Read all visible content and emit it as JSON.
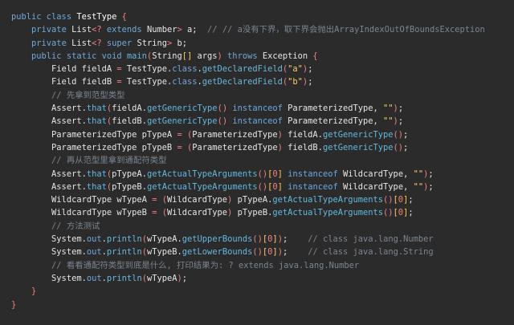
{
  "colors": {
    "background": "#2b2b2b",
    "keyword": "#6fa8dc",
    "method": "#66b8dd",
    "string": "#ffcc66",
    "comment": "#7a8590",
    "operator": "#f08080",
    "default": "#e6e6e6"
  },
  "lines": [
    [
      [
        "keyword",
        "public class "
      ],
      [
        "class",
        "TestType"
      ],
      [
        "brace",
        " {"
      ]
    ],
    [
      [
        "plain",
        "    "
      ],
      [
        "keyword",
        "private "
      ],
      [
        "type",
        "List"
      ],
      [
        "operator",
        "<? "
      ],
      [
        "keyword",
        "extends "
      ],
      [
        "type",
        "Number"
      ],
      [
        "operator",
        "> "
      ],
      [
        "ident",
        "a"
      ],
      [
        "punct",
        ";  "
      ],
      [
        "comment",
        "// // a没有下界，取下界会抛出ArrayIndexOutOfBoundsException"
      ]
    ],
    [
      [
        "plain",
        "    "
      ],
      [
        "keyword",
        "private "
      ],
      [
        "type",
        "List"
      ],
      [
        "operator",
        "<? "
      ],
      [
        "keyword",
        "super "
      ],
      [
        "type",
        "String"
      ],
      [
        "operator",
        "> "
      ],
      [
        "ident",
        "b"
      ],
      [
        "punct",
        ";"
      ]
    ],
    [
      [
        "plain",
        "    "
      ],
      [
        "keyword",
        "public static void "
      ],
      [
        "method",
        "main"
      ],
      [
        "paren",
        "("
      ],
      [
        "type",
        "String"
      ],
      [
        "bracket",
        "[]"
      ],
      [
        "ident",
        " args"
      ],
      [
        "paren",
        ")"
      ],
      [
        "keyword",
        " throws "
      ],
      [
        "type",
        "Exception"
      ],
      [
        "brace",
        " {"
      ]
    ],
    [
      [
        "plain",
        "        "
      ],
      [
        "type",
        "Field "
      ],
      [
        "ident",
        "fieldA"
      ],
      [
        "operator",
        " = "
      ],
      [
        "type",
        "TestType"
      ],
      [
        "punct",
        "."
      ],
      [
        "keyword",
        "class"
      ],
      [
        "punct",
        "."
      ],
      [
        "method",
        "getDeclaredField"
      ],
      [
        "paren",
        "("
      ],
      [
        "string",
        "\"a\""
      ],
      [
        "paren",
        ")"
      ],
      [
        "punct",
        ";"
      ]
    ],
    [
      [
        "plain",
        "        "
      ],
      [
        "type",
        "Field "
      ],
      [
        "ident",
        "fieldB"
      ],
      [
        "operator",
        " = "
      ],
      [
        "type",
        "TestType"
      ],
      [
        "punct",
        "."
      ],
      [
        "keyword",
        "class"
      ],
      [
        "punct",
        "."
      ],
      [
        "method",
        "getDeclaredField"
      ],
      [
        "paren",
        "("
      ],
      [
        "string",
        "\"b\""
      ],
      [
        "paren",
        ")"
      ],
      [
        "punct",
        ";"
      ]
    ],
    [
      [
        "plain",
        "        "
      ],
      [
        "comment",
        "// 先拿到范型类型"
      ]
    ],
    [
      [
        "plain",
        "        "
      ],
      [
        "type",
        "Assert"
      ],
      [
        "punct",
        "."
      ],
      [
        "method",
        "that"
      ],
      [
        "paren",
        "("
      ],
      [
        "ident",
        "fieldA"
      ],
      [
        "punct",
        "."
      ],
      [
        "method",
        "getGenericType"
      ],
      [
        "paren",
        "()"
      ],
      [
        "keyword",
        " instanceof "
      ],
      [
        "type",
        "ParameterizedType"
      ],
      [
        "punct",
        ", "
      ],
      [
        "string",
        "\"\""
      ],
      [
        "paren",
        ")"
      ],
      [
        "punct",
        ";"
      ]
    ],
    [
      [
        "plain",
        "        "
      ],
      [
        "type",
        "Assert"
      ],
      [
        "punct",
        "."
      ],
      [
        "method",
        "that"
      ],
      [
        "paren",
        "("
      ],
      [
        "ident",
        "fieldB"
      ],
      [
        "punct",
        "."
      ],
      [
        "method",
        "getGenericType"
      ],
      [
        "paren",
        "()"
      ],
      [
        "keyword",
        " instanceof "
      ],
      [
        "type",
        "ParameterizedType"
      ],
      [
        "punct",
        ", "
      ],
      [
        "string",
        "\"\""
      ],
      [
        "paren",
        ")"
      ],
      [
        "punct",
        ";"
      ]
    ],
    [
      [
        "plain",
        "        "
      ],
      [
        "type",
        "ParameterizedType "
      ],
      [
        "ident",
        "pTypeA"
      ],
      [
        "operator",
        " = "
      ],
      [
        "paren",
        "("
      ],
      [
        "type",
        "ParameterizedType"
      ],
      [
        "paren",
        ")"
      ],
      [
        "ident",
        " fieldA"
      ],
      [
        "punct",
        "."
      ],
      [
        "method",
        "getGenericType"
      ],
      [
        "paren",
        "()"
      ],
      [
        "punct",
        ";"
      ]
    ],
    [
      [
        "plain",
        "        "
      ],
      [
        "type",
        "ParameterizedType "
      ],
      [
        "ident",
        "pTypeB"
      ],
      [
        "operator",
        " = "
      ],
      [
        "paren",
        "("
      ],
      [
        "type",
        "ParameterizedType"
      ],
      [
        "paren",
        ")"
      ],
      [
        "ident",
        " fieldB"
      ],
      [
        "punct",
        "."
      ],
      [
        "method",
        "getGenericType"
      ],
      [
        "paren",
        "()"
      ],
      [
        "punct",
        ";"
      ]
    ],
    [
      [
        "plain",
        "        "
      ],
      [
        "comment",
        "// 再从范型里拿到通配符类型"
      ]
    ],
    [
      [
        "plain",
        "        "
      ],
      [
        "type",
        "Assert"
      ],
      [
        "punct",
        "."
      ],
      [
        "method",
        "that"
      ],
      [
        "paren",
        "("
      ],
      [
        "ident",
        "pTypeA"
      ],
      [
        "punct",
        "."
      ],
      [
        "method",
        "getActualTypeArguments"
      ],
      [
        "paren",
        "()"
      ],
      [
        "bracket",
        "["
      ],
      [
        "number",
        "0"
      ],
      [
        "bracket",
        "]"
      ],
      [
        "keyword",
        " instanceof "
      ],
      [
        "type",
        "WildcardType"
      ],
      [
        "punct",
        ", "
      ],
      [
        "string",
        "\"\""
      ],
      [
        "paren",
        ")"
      ],
      [
        "punct",
        ";"
      ]
    ],
    [
      [
        "plain",
        "        "
      ],
      [
        "type",
        "Assert"
      ],
      [
        "punct",
        "."
      ],
      [
        "method",
        "that"
      ],
      [
        "paren",
        "("
      ],
      [
        "ident",
        "pTypeB"
      ],
      [
        "punct",
        "."
      ],
      [
        "method",
        "getActualTypeArguments"
      ],
      [
        "paren",
        "()"
      ],
      [
        "bracket",
        "["
      ],
      [
        "number",
        "0"
      ],
      [
        "bracket",
        "]"
      ],
      [
        "keyword",
        " instanceof "
      ],
      [
        "type",
        "WildcardType"
      ],
      [
        "punct",
        ", "
      ],
      [
        "string",
        "\"\""
      ],
      [
        "paren",
        ")"
      ],
      [
        "punct",
        ";"
      ]
    ],
    [
      [
        "plain",
        "        "
      ],
      [
        "type",
        "WildcardType "
      ],
      [
        "ident",
        "wTypeA"
      ],
      [
        "operator",
        " = "
      ],
      [
        "paren",
        "("
      ],
      [
        "type",
        "WildcardType"
      ],
      [
        "paren",
        ")"
      ],
      [
        "ident",
        " pTypeA"
      ],
      [
        "punct",
        "."
      ],
      [
        "method",
        "getActualTypeArguments"
      ],
      [
        "paren",
        "()"
      ],
      [
        "bracket",
        "["
      ],
      [
        "number",
        "0"
      ],
      [
        "bracket",
        "]"
      ],
      [
        "punct",
        ";"
      ]
    ],
    [
      [
        "plain",
        "        "
      ],
      [
        "type",
        "WildcardType "
      ],
      [
        "ident",
        "wTypeB"
      ],
      [
        "operator",
        " = "
      ],
      [
        "paren",
        "("
      ],
      [
        "type",
        "WildcardType"
      ],
      [
        "paren",
        ")"
      ],
      [
        "ident",
        " pTypeB"
      ],
      [
        "punct",
        "."
      ],
      [
        "method",
        "getActualTypeArguments"
      ],
      [
        "paren",
        "()"
      ],
      [
        "bracket",
        "["
      ],
      [
        "number",
        "0"
      ],
      [
        "bracket",
        "]"
      ],
      [
        "punct",
        ";"
      ]
    ],
    [
      [
        "plain",
        "        "
      ],
      [
        "comment",
        "// 方法测试"
      ]
    ],
    [
      [
        "plain",
        "        "
      ],
      [
        "type",
        "System"
      ],
      [
        "punct",
        "."
      ],
      [
        "static",
        "out"
      ],
      [
        "punct",
        "."
      ],
      [
        "method",
        "println"
      ],
      [
        "paren",
        "("
      ],
      [
        "ident",
        "wTypeA"
      ],
      [
        "punct",
        "."
      ],
      [
        "method",
        "getUpperBounds"
      ],
      [
        "paren",
        "()"
      ],
      [
        "bracket",
        "["
      ],
      [
        "number",
        "0"
      ],
      [
        "bracket",
        "]"
      ],
      [
        "paren",
        ")"
      ],
      [
        "punct",
        ";    "
      ],
      [
        "comment",
        "// class java.lang.Number"
      ]
    ],
    [
      [
        "plain",
        "        "
      ],
      [
        "type",
        "System"
      ],
      [
        "punct",
        "."
      ],
      [
        "static",
        "out"
      ],
      [
        "punct",
        "."
      ],
      [
        "method",
        "println"
      ],
      [
        "paren",
        "("
      ],
      [
        "ident",
        "wTypeB"
      ],
      [
        "punct",
        "."
      ],
      [
        "method",
        "getLowerBounds"
      ],
      [
        "paren",
        "()"
      ],
      [
        "bracket",
        "["
      ],
      [
        "number",
        "0"
      ],
      [
        "bracket",
        "]"
      ],
      [
        "paren",
        ")"
      ],
      [
        "punct",
        ";    "
      ],
      [
        "comment",
        "// class java.lang.String"
      ]
    ],
    [
      [
        "plain",
        "        "
      ],
      [
        "comment",
        "// 看看通配符类型到底是什么, 打印结果为: ? extends java.lang.Number"
      ]
    ],
    [
      [
        "plain",
        "        "
      ],
      [
        "type",
        "System"
      ],
      [
        "punct",
        "."
      ],
      [
        "static",
        "out"
      ],
      [
        "punct",
        "."
      ],
      [
        "method",
        "println"
      ],
      [
        "paren",
        "("
      ],
      [
        "ident",
        "wTypeA"
      ],
      [
        "paren",
        ")"
      ],
      [
        "punct",
        ";"
      ]
    ],
    [
      [
        "plain",
        "    "
      ],
      [
        "brace",
        "}"
      ]
    ],
    [
      [
        "brace",
        "}"
      ]
    ]
  ]
}
